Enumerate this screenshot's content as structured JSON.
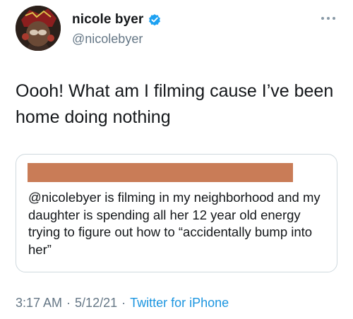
{
  "author": {
    "display_name": "nicole byer",
    "handle": "@nicolebyer",
    "verified": true
  },
  "tweet": {
    "text": "Oooh! What am I filming cause I’ve been home doing nothing"
  },
  "quoted_tweet": {
    "text": "@nicolebyer is filming in my neighborhood and my daughter is spending all her 12 year old energy trying to figure out how to “accidentally bump into her”"
  },
  "meta": {
    "time": "3:17 AM",
    "separator": "·",
    "date": "5/12/21",
    "source": "Twitter for iPhone"
  },
  "colors": {
    "verified": "#1da1f2",
    "link": "#1b95e0",
    "redaction": "#c97c57",
    "secondary_text": "#657786"
  },
  "icons": {
    "verified": "verified-badge-icon",
    "more": "more-options-icon"
  }
}
